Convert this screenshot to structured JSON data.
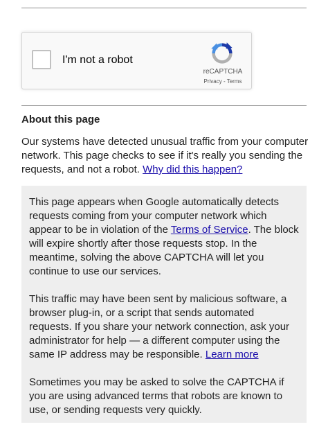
{
  "captcha": {
    "checkbox_label": "I'm not a robot",
    "brand": "reCAPTCHA",
    "privacy_link": "Privacy",
    "separator": " - ",
    "terms_link": "Terms"
  },
  "about": {
    "heading": "About this page",
    "text": "Our systems have detected unusual traffic from your computer network. This page checks to see if it's really you sending the requests, and not a robot. ",
    "why_link": "Why did this happen?"
  },
  "info": {
    "p1_before": "This page appears when Google automatically detects requests coming from your computer network which appear to be in violation of the ",
    "p1_link": "Terms of Service",
    "p1_after": ". The block will expire shortly after those requests stop. In the meantime, solving the above CAPTCHA will let you continue to use our services.",
    "p2_before": "This traffic may have been sent by malicious software, a browser plug-in, or a script that sends automated requests. If you share your network connection, ask your administrator for help — a different computer using the same IP address may be responsible. ",
    "p2_link": "Learn more",
    "p3": "Sometimes you may be asked to solve the CAPTCHA if you are using advanced terms that robots are known to use, or sending requests very quickly."
  },
  "icons": {
    "captcha_checkbox": "checkbox-icon",
    "recaptcha_logo": "recaptcha-logo-icon"
  },
  "colors": {
    "link": "#1a0dab",
    "info_background": "#eeeeee",
    "logo_blue": "#4a90e2",
    "logo_dark_blue": "#1c3aa9",
    "logo_grey": "#b0b0b0"
  }
}
